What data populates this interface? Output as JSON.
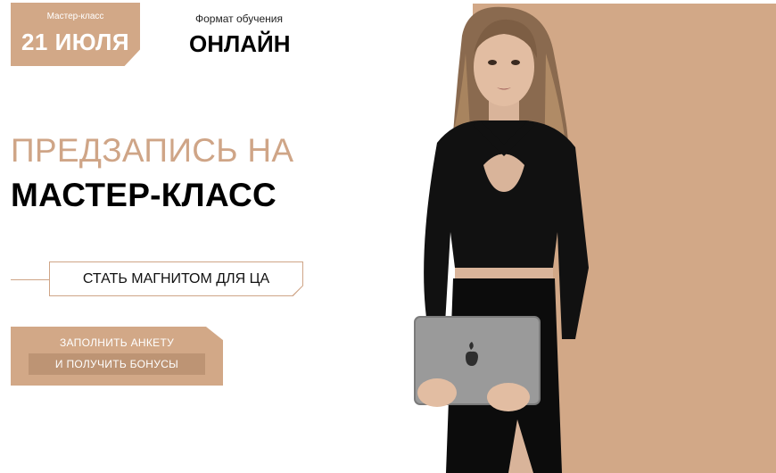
{
  "date_badge": {
    "label": "Мастер-класс",
    "date": "21 ИЮЛЯ"
  },
  "format": {
    "label": "Формат обучения",
    "value": "ОНЛАЙН"
  },
  "headline": {
    "line1": "ПРЕДЗАПИСЬ НА",
    "line2": "МАСТЕР-КЛАСС"
  },
  "tagline": "СТАТЬ МАГНИТОМ ДЛЯ ЦА",
  "cta": {
    "line1": "ЗАПОЛНИТЬ АНКЕТУ",
    "line2": "И ПОЛУЧИТЬ БОНУСЫ"
  },
  "colors": {
    "accent": "#d2a887",
    "accent_dark": "#bd9474",
    "text": "#000000",
    "background": "#ffffff"
  },
  "images": {
    "hero": "woman-holding-laptop-photo",
    "laptop_logo": "apple-logo-icon"
  }
}
